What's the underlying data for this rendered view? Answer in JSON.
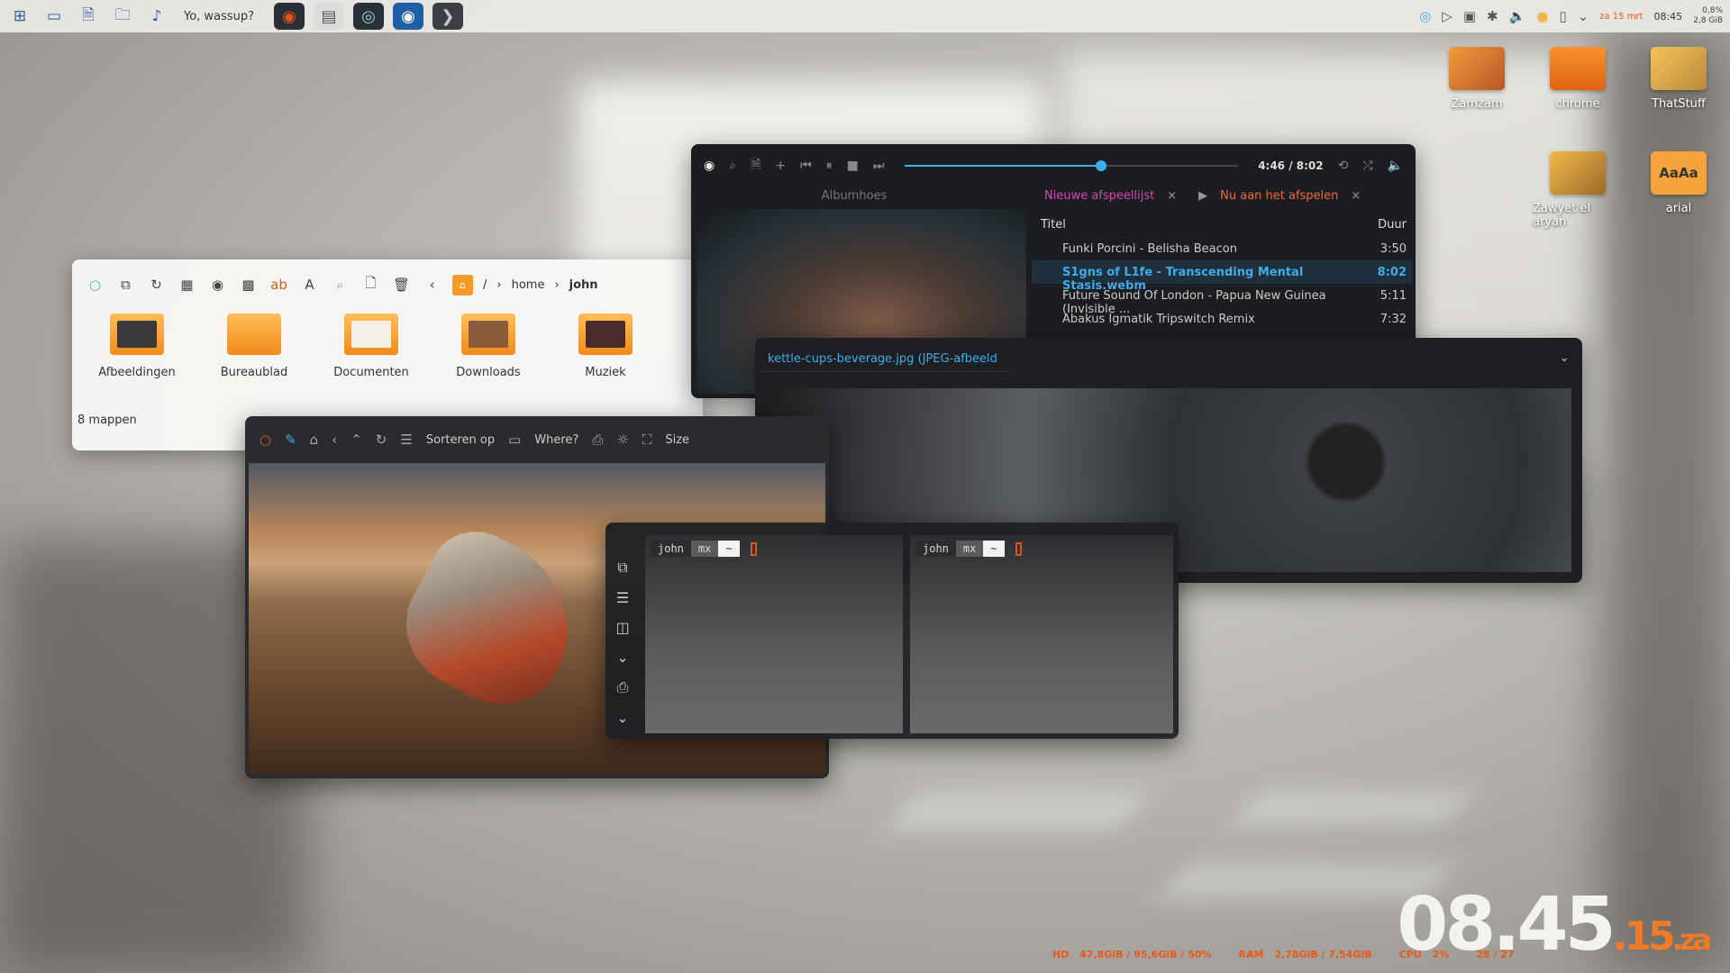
{
  "topbar": {
    "title": "Yo, wassup?",
    "launchers": [
      "window-switcher-icon",
      "screenshot-icon",
      "document-search-icon",
      "folder-icon",
      "music-note-icon"
    ],
    "tasks": [
      "music-player-task",
      "file-manager-task",
      "image-viewer-task",
      "browser-task",
      "terminal-task"
    ],
    "tray_date": "za 15 mrt",
    "tray_time": "08:45",
    "tray_cpu": "0,8%",
    "tray_mem": "2,8 GiB"
  },
  "desktop": {
    "icons": [
      {
        "label": "Zamzam"
      },
      {
        "label": "chrome"
      },
      {
        "label": "ThatStuff"
      },
      {
        "label": "Zawyet el aryan"
      },
      {
        "label": "arial"
      }
    ]
  },
  "file_manager": {
    "breadcrumb": {
      "root": "/",
      "home": "home",
      "user": "john"
    },
    "folders": [
      {
        "label": "Afbeeldingen"
      },
      {
        "label": "Bureaublad"
      },
      {
        "label": "Documenten"
      },
      {
        "label": "Downloads"
      },
      {
        "label": "Muziek"
      }
    ],
    "status": "8 mappen"
  },
  "player": {
    "time": "4:46 / 8:02",
    "progress": 0.59,
    "cover_label": "Albumhoes",
    "tabs": {
      "playlist": "Nieuwe afspeellijst",
      "now_playing": "Nu aan het afspelen"
    },
    "columns": {
      "title": "Titel",
      "duration": "Duur"
    },
    "tracks": [
      {
        "title": "Funki Porcini - Belisha Beacon",
        "duration": "3:50"
      },
      {
        "title": "S1gns of L1fe - Transcending Mental Stasis.webm",
        "duration": "8:02"
      },
      {
        "title": "Future Sound Of London - Papua New Guinea (Invisible ...",
        "duration": "5:11"
      },
      {
        "title": "Abakus Igmatik Tripswitch Remix",
        "duration": "7:32"
      }
    ]
  },
  "dark_viewer": {
    "tab_label": "kettle-cups-beverage.jpg (JPEG-afbeeld"
  },
  "boat_viewer": {
    "sort_label": "Sorteren op",
    "where_label": "Where?",
    "size_label": "Size"
  },
  "terminal": {
    "user": "john",
    "host": "mx",
    "dir": "~"
  },
  "status": {
    "hd_label": "HD",
    "hd_value": "47,8GiB / 95,6GiB / 50%",
    "ram_label": "RAM",
    "ram_value": "2,78GiB / 7,54GiB",
    "cpu_label": "CPU",
    "cpu_value": "2%",
    "temp_a": "28",
    "temp_b": "27"
  },
  "clock": {
    "hours_minutes": "08.45",
    "seconds": ".15",
    "day": ".za"
  },
  "colors": {
    "accent": "#3daee9",
    "orange": "#ef7a2a",
    "playlist_tab": "#d14bb0"
  }
}
